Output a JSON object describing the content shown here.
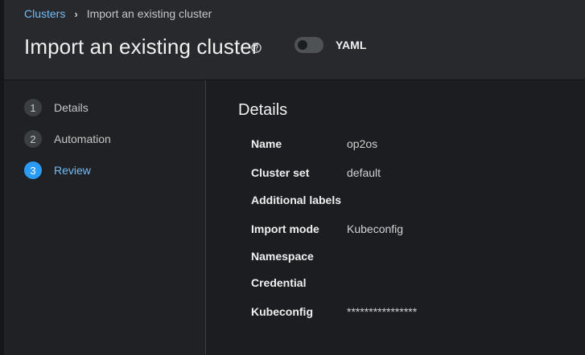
{
  "breadcrumb": {
    "parent": "Clusters",
    "separator": "›",
    "current": "Import an existing cluster"
  },
  "header": {
    "title": "Import an existing cluster",
    "help_icon": "question-circle-icon",
    "yaml_toggle_label": "YAML",
    "yaml_toggle_on": false
  },
  "wizard": {
    "steps": [
      {
        "number": "1",
        "label": "Details",
        "current": false
      },
      {
        "number": "2",
        "label": "Automation",
        "current": false
      },
      {
        "number": "3",
        "label": "Review",
        "current": true
      }
    ]
  },
  "review": {
    "section_title": "Details",
    "fields": [
      {
        "term": "Name",
        "value": "op2os"
      },
      {
        "term": "Cluster set",
        "value": "default"
      },
      {
        "term": "Additional labels",
        "value": ""
      },
      {
        "term": "Import mode",
        "value": "Kubeconfig"
      },
      {
        "term": "Namespace",
        "value": ""
      },
      {
        "term": "Credential",
        "value": ""
      },
      {
        "term": "Kubeconfig",
        "value": "****************"
      }
    ]
  },
  "colors": {
    "link": "#73bcf7",
    "active_step": "#2b9af3",
    "header_bg": "#27292d",
    "page_bg": "#1b1d21"
  }
}
